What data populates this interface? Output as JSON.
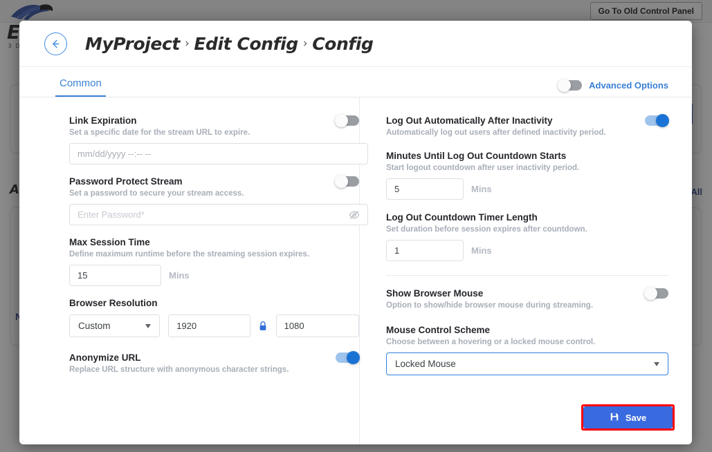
{
  "background": {
    "brand": "EI",
    "brand_sub": "3 D",
    "old_panel_button": "Go To Old Control Panel",
    "section_title": "Ap",
    "view_all": "All",
    "side_link": "N"
  },
  "modal": {
    "back_icon": "arrow-left-icon",
    "breadcrumb": [
      {
        "label": "MyProject"
      },
      {
        "label": "Edit Config"
      },
      {
        "label": "Config"
      }
    ],
    "breadcrumb_separator": "›",
    "tabs": [
      {
        "label": "Common",
        "active": true
      }
    ],
    "advanced_options": {
      "label": "Advanced Options",
      "enabled": false
    },
    "left_column": [
      {
        "key": "link_expiration",
        "title": "Link Expiration",
        "desc": "Set a specific date for the stream URL to expire.",
        "toggle": false,
        "input_placeholder": "mm/dd/yyyy --:-- --",
        "input_value": ""
      },
      {
        "key": "password_protect_stream",
        "title": "Password Protect Stream",
        "desc": "Set a password to secure your stream access.",
        "toggle": false,
        "input_placeholder": "Enter Password*",
        "input_value": "",
        "eye_icon": "eye-off-icon"
      },
      {
        "key": "max_session_time",
        "title": "Max Session Time",
        "desc": "Define maximum runtime before the streaming session expires.",
        "input_value": "15",
        "unit": "Mins"
      },
      {
        "key": "browser_resolution",
        "title": "Browser Resolution",
        "preset": "Custom",
        "width": "1920",
        "height": "1080",
        "lock_icon": "lock-closed-icon"
      },
      {
        "key": "anonymize_url",
        "title": "Anonymize URL",
        "desc": "Replace URL structure with anonymous character strings.",
        "toggle": true
      }
    ],
    "right_column": [
      {
        "key": "log_out_automatically",
        "title": "Log Out Automatically After Inactivity",
        "desc": "Automatically log out users after defined inactivity period.",
        "toggle": true
      },
      {
        "key": "minutes_until_countdown",
        "title": "Minutes Until Log Out Countdown Starts",
        "desc": "Start logout countdown after user inactivity period.",
        "input_value": "5",
        "unit": "Mins"
      },
      {
        "key": "countdown_timer_length",
        "title": "Log Out Countdown Timer Length",
        "desc": "Set duration before session expires after countdown.",
        "input_value": "1",
        "unit": "Mins"
      },
      {
        "key": "show_browser_mouse",
        "title": "Show Browser Mouse",
        "desc": "Option to show/hide browser mouse during streaming.",
        "toggle": false
      },
      {
        "key": "mouse_control_scheme",
        "title": "Mouse Control Scheme",
        "desc": "Choose between a hovering or a locked mouse control.",
        "selected": "Locked Mouse"
      }
    ],
    "save_button": {
      "label": "Save",
      "icon": "save-disk-icon",
      "highlight_color": "#ff0000",
      "color": "#3a6ae0"
    }
  }
}
